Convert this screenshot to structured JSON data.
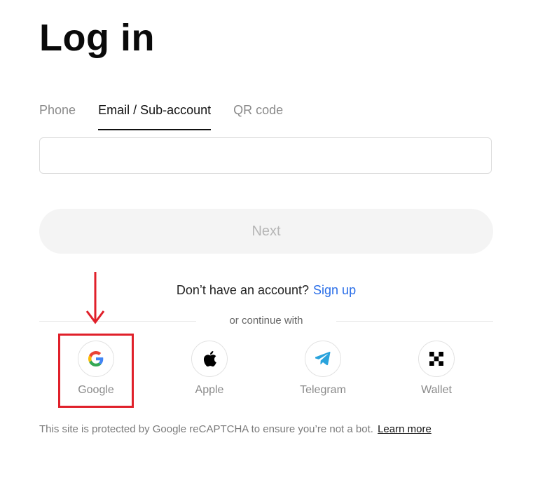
{
  "title": "Log in",
  "tabs": [
    {
      "label": "Phone",
      "active": false
    },
    {
      "label": "Email / Sub-account",
      "active": true
    },
    {
      "label": "QR code",
      "active": false
    }
  ],
  "email_input": {
    "value": "",
    "placeholder": ""
  },
  "next_button": {
    "label": "Next"
  },
  "signup": {
    "prompt": "Don’t have an account?",
    "link": "Sign up"
  },
  "divider_label": "or continue with",
  "providers": [
    {
      "label": "Google",
      "icon": "google-icon"
    },
    {
      "label": "Apple",
      "icon": "apple-icon"
    },
    {
      "label": "Telegram",
      "icon": "telegram-icon"
    },
    {
      "label": "Wallet",
      "icon": "wallet-icon"
    }
  ],
  "footer": {
    "note": "This site is protected by Google reCAPTCHA to ensure you’re not a bot.",
    "link": "Learn more"
  },
  "colors": {
    "accent_link": "#2a6ee8",
    "highlight": "#e0202a",
    "telegram": "#2aa3dc",
    "button_disabled_bg": "#f4f4f4"
  }
}
